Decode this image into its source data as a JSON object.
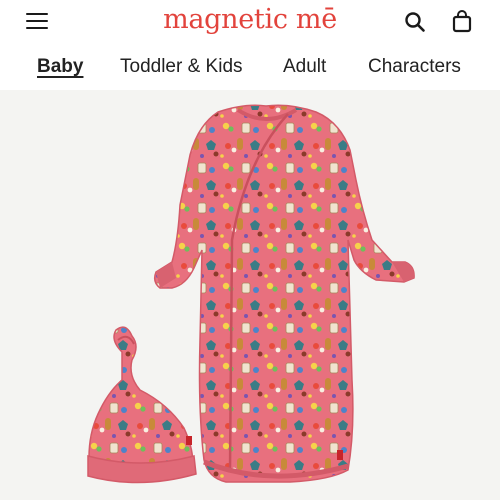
{
  "header": {
    "logo_text": "magnetic mē",
    "menu_icon": "hamburger-menu-icon",
    "search_icon": "search-icon",
    "bag_icon": "shopping-bag-icon",
    "brand_color": "#e2433c"
  },
  "nav": {
    "items": [
      {
        "label": "Baby",
        "active": true
      },
      {
        "label": "Toddler & Kids",
        "active": false
      },
      {
        "label": "Adult",
        "active": false
      },
      {
        "label": "Characters",
        "active": false
      }
    ]
  },
  "product": {
    "image_bg": "#f4f4f2",
    "fabric_color": "#e8707e",
    "items": [
      "gown-image",
      "knot-hat-image"
    ]
  }
}
